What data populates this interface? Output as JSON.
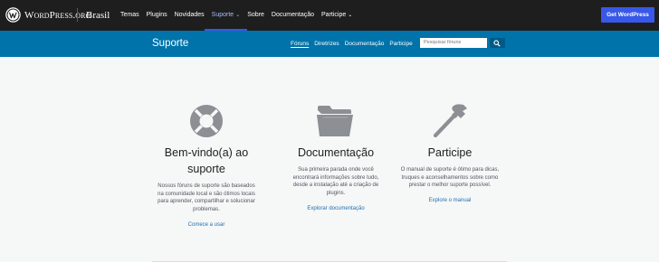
{
  "global_header": {
    "brand": "WordPress.org",
    "locale": "Brasil",
    "nav": [
      {
        "label": "Temas",
        "active": false
      },
      {
        "label": "Plugins",
        "active": false
      },
      {
        "label": "Novidades",
        "active": false
      },
      {
        "label": "Suporte",
        "active": true,
        "has_dropdown": true
      },
      {
        "label": "Sobre",
        "active": false
      },
      {
        "label": "Documentação",
        "active": false
      },
      {
        "label": "Participe",
        "active": false,
        "has_dropdown": true
      }
    ],
    "cta_label": "Get WordPress",
    "colors": {
      "background": "#1e1e1e",
      "accent": "#3858e9"
    }
  },
  "local_nav": {
    "title": "Suporte",
    "items": [
      {
        "label": "Fóruns",
        "active": true
      },
      {
        "label": "Diretrizes",
        "active": false
      },
      {
        "label": "Documentação",
        "active": false
      },
      {
        "label": "Participe",
        "active": false
      }
    ],
    "search_placeholder": "Pesquisar fóruns",
    "colors": {
      "background": "#0073aa"
    }
  },
  "cards": [
    {
      "icon": "lifebuoy-icon",
      "title_lines": [
        "Bem-vindo(a) ao",
        "suporte"
      ],
      "description_lines": [
        "Nossos fóruns de suporte são baseados",
        "na comunidade local e são ótimos locais",
        "para aprender, compartilhar e solucionar",
        "problemas."
      ],
      "link": "Comece a usar"
    },
    {
      "icon": "folder-icon",
      "title_lines": [
        "Documentação"
      ],
      "description_lines": [
        "Sua primeira parada onde você",
        "encontrará informações sobre tudo,",
        "desde a instalação até a criação de",
        "plugins."
      ],
      "link": "Explorar documentação"
    },
    {
      "icon": "hammer-icon",
      "title_lines": [
        "Participe"
      ],
      "description_lines": [
        "O manual de suporte é ótimo para dicas,",
        "truques e aconselhamentos sobre como",
        "prestar o melhor suporte possível."
      ],
      "link": "Explore o manual"
    }
  ]
}
